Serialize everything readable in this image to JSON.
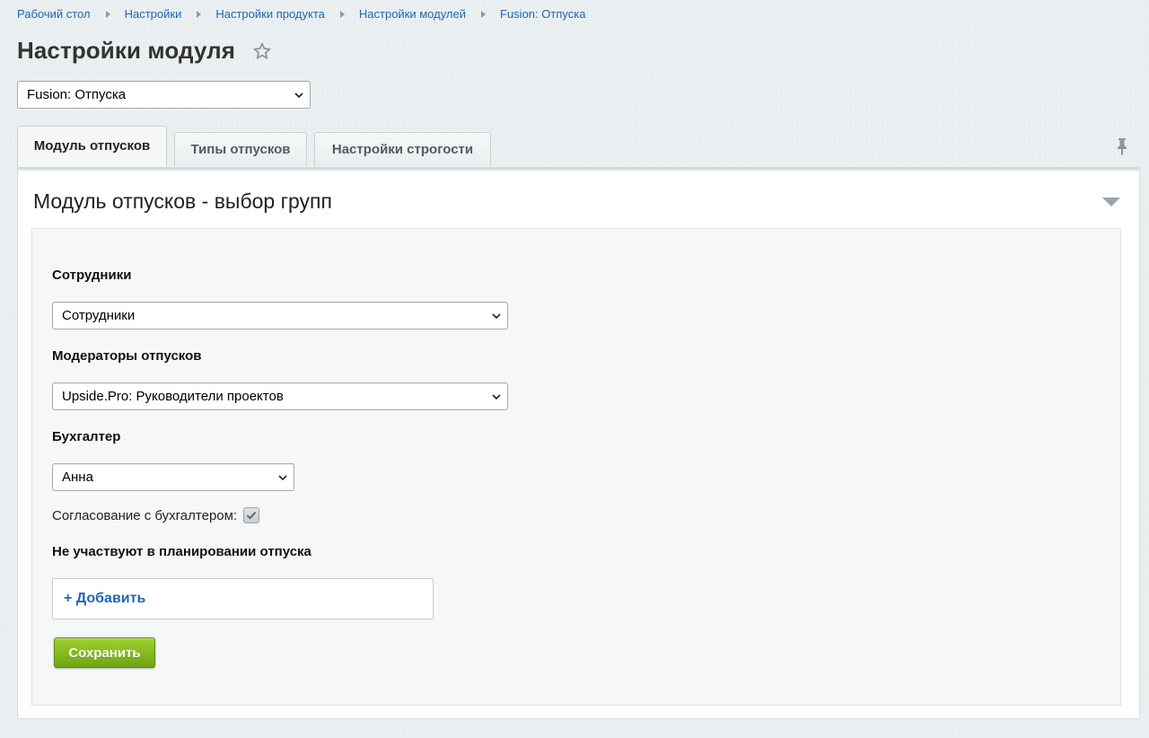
{
  "breadcrumbs": [
    "Рабочий стол",
    "Настройки",
    "Настройки продукта",
    "Настройки модулей",
    "Fusion: Отпуска"
  ],
  "page": {
    "title": "Настройки модуля",
    "module_select_value": "Fusion: Отпуска"
  },
  "tabs": [
    {
      "label": "Модуль отпусков",
      "active": true
    },
    {
      "label": "Типы отпусков",
      "active": false
    },
    {
      "label": "Настройки строгости",
      "active": false
    }
  ],
  "section": {
    "title": "Модуль отпусков - выбор групп"
  },
  "form": {
    "employees": {
      "label": "Сотрудники",
      "value": "Сотрудники"
    },
    "moderators": {
      "label": "Модераторы отпусков",
      "value": "Upside.Pro: Руководители проектов"
    },
    "accountant": {
      "label": "Бухгалтер",
      "value": "Анна"
    },
    "accountant_approval": {
      "label": "Согласование с бухгалтером:",
      "checked": true
    },
    "excluded": {
      "label": "Не участвуют в планировании отпуска",
      "add_label": "+ Добавить"
    },
    "save_label": "Сохранить"
  },
  "icons": {
    "favorite": "star-icon",
    "pin": "pin-icon",
    "collapse": "triangle-down-icon",
    "select": "chevron-down-icon",
    "check": "check-icon"
  },
  "colors": {
    "link": "#2067b0",
    "save_button": "#82b91f",
    "background": "#e9eef0"
  }
}
